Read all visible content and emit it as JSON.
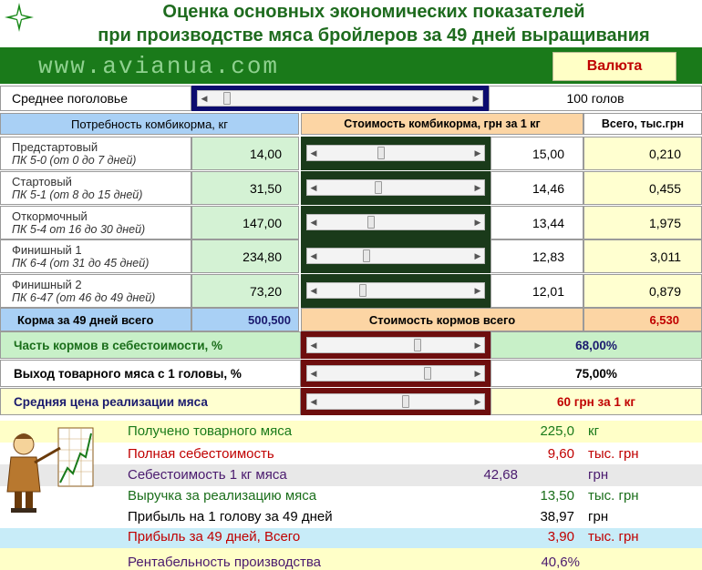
{
  "title": {
    "line1": "Оценка основных экономических показателей",
    "line2": "при производстве мяса бройлеров за 49 дней выращивания"
  },
  "site": "www.avianua.com",
  "currency_button": "Валюта",
  "herd": {
    "label": "Среднее поголовье",
    "value": "100 голов",
    "slider": 0.05
  },
  "headers": {
    "need": "Потребность комбикорма, кг",
    "cost": "Стоимость комбикорма, грн за 1 кг",
    "total": "Всего, тыс.грн"
  },
  "feeds": [
    {
      "name": "Предстартовый",
      "sub": "ПК 5-0 (от 0 до 7 дней)",
      "qty": "14,00",
      "price": "15,00",
      "total": "0,210",
      "slider": 0.4
    },
    {
      "name": "Стартовый",
      "sub": "ПК 5-1 (от 8 до 15 дней)",
      "qty": "31,50",
      "price": "14,46",
      "total": "0,455",
      "slider": 0.38
    },
    {
      "name": "Откормочный",
      "sub": "ПК 5-4 от 16 до 30 дней)",
      "qty": "147,00",
      "price": "13,44",
      "total": "1,975",
      "slider": 0.33
    },
    {
      "name": "Финишный 1",
      "sub": " ПК 6-4 (от 31 до 45 дней)",
      "qty": "234,80",
      "price": "12,83",
      "total": "3,011",
      "slider": 0.3
    },
    {
      "name": "Финишный 2",
      "sub": "ПК 6-47 (от 46 до 49 дней)",
      "qty": "73,20",
      "price": "12,01",
      "total": "0,879",
      "slider": 0.27
    }
  ],
  "totals": {
    "feed_label": "Корма за 49 дней всего",
    "feed_value": "500,500",
    "cost_label": "Стоимость кормов всего",
    "cost_value": "6,530"
  },
  "params": [
    {
      "label": "Часть кормов в себестоимости, %",
      "value": "68,00%",
      "slider": 0.65
    },
    {
      "label": "Выход товарного мяса с 1 головы, %",
      "value": "75,00%",
      "slider": 0.72
    },
    {
      "label": "Средняя цена реализации мяса",
      "value": "60  грн за 1 кг",
      "slider": 0.57
    }
  ],
  "results": [
    {
      "label": "Получено товарного мяса",
      "value": "225,0",
      "unit": "кг"
    },
    {
      "label": "Полная себестоимость",
      "value": "9,60",
      "unit": "тыс. грн"
    },
    {
      "label": "Себестоимость 1 кг мяса",
      "value": "42,68",
      "unit": "грн"
    },
    {
      "label": "Выручка за реализацию мяса",
      "value": "13,50",
      "unit": "тыс. грн"
    },
    {
      "label": "Прибыль на 1 голову за 49 дней",
      "value": "38,97",
      "unit": "грн"
    },
    {
      "label": "Прибыль за 49 дней, Всего",
      "value": "3,90",
      "unit": "тыс. грн"
    },
    {
      "label": "Рентабельность производства",
      "value": "40,6%",
      "unit": ""
    }
  ]
}
